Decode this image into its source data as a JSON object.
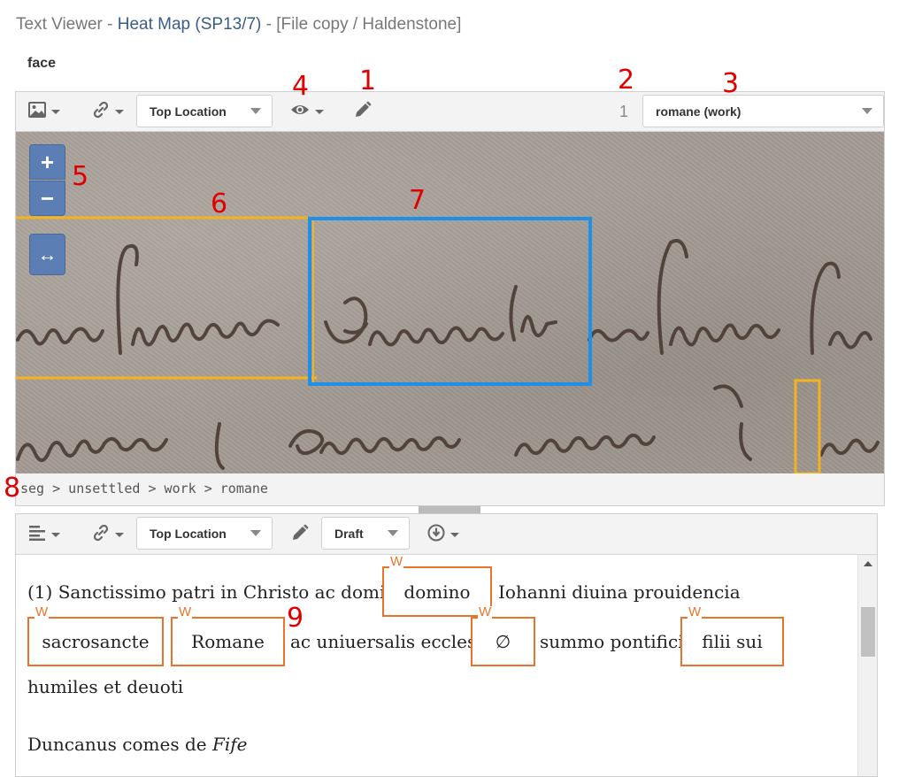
{
  "header": {
    "app_name": "Text Viewer",
    "sep1": " - ",
    "document": "Heat Map (SP13/7)",
    "sep2": " - ",
    "location": "[File copy / Haldenstone]"
  },
  "face_label": "face",
  "image_viewer": {
    "toolbar": {
      "image_menu_icon": "image-icon",
      "link_menu_icon": "link-icon",
      "location_select": "Top Location",
      "visibility_icon": "eye-icon",
      "edit_icon": "pencil-icon",
      "count": "1",
      "annotation_select": "romane (work)"
    },
    "zoom_in_label": "+",
    "zoom_out_label": "−",
    "fit_label": "↔",
    "path": "seg > unsettled > work > romane"
  },
  "text_editor": {
    "toolbar": {
      "format_menu_icon": "align-left-icon",
      "link_menu_icon": "link-icon",
      "location_select": "Top Location",
      "edit_icon": "pencil-icon",
      "status_select": "Draft",
      "download_icon": "download-icon"
    },
    "line1": "(1) Sanctissimo patri in Christo ac domino",
    "line1_after": "Iohanni diuina prouidencia",
    "line2_mid": "ac uniuersalis ecclesie",
    "line2_after": "summo pontifici",
    "line3": "humiles et deuoti",
    "line4_plain": "Duncanus comes de ",
    "line4_italic": "Fife",
    "word_tag": "W",
    "words": {
      "w1": "domino",
      "w2": "sacrosancte",
      "w3": "Romane",
      "w4": "∅",
      "w5": "filii sui"
    }
  },
  "annotations": {
    "a1": "1",
    "a2": "2",
    "a3": "3",
    "a4": "4",
    "a5": "5",
    "a6": "6",
    "a7": "7",
    "a8": "8",
    "a9": "9"
  },
  "colors": {
    "zone_selected": "#1e90e8",
    "zone_other": "#f2b31e",
    "word_border": "#e8742c",
    "annotation": "#e00000",
    "zoom_button": "#5b7fb4"
  }
}
